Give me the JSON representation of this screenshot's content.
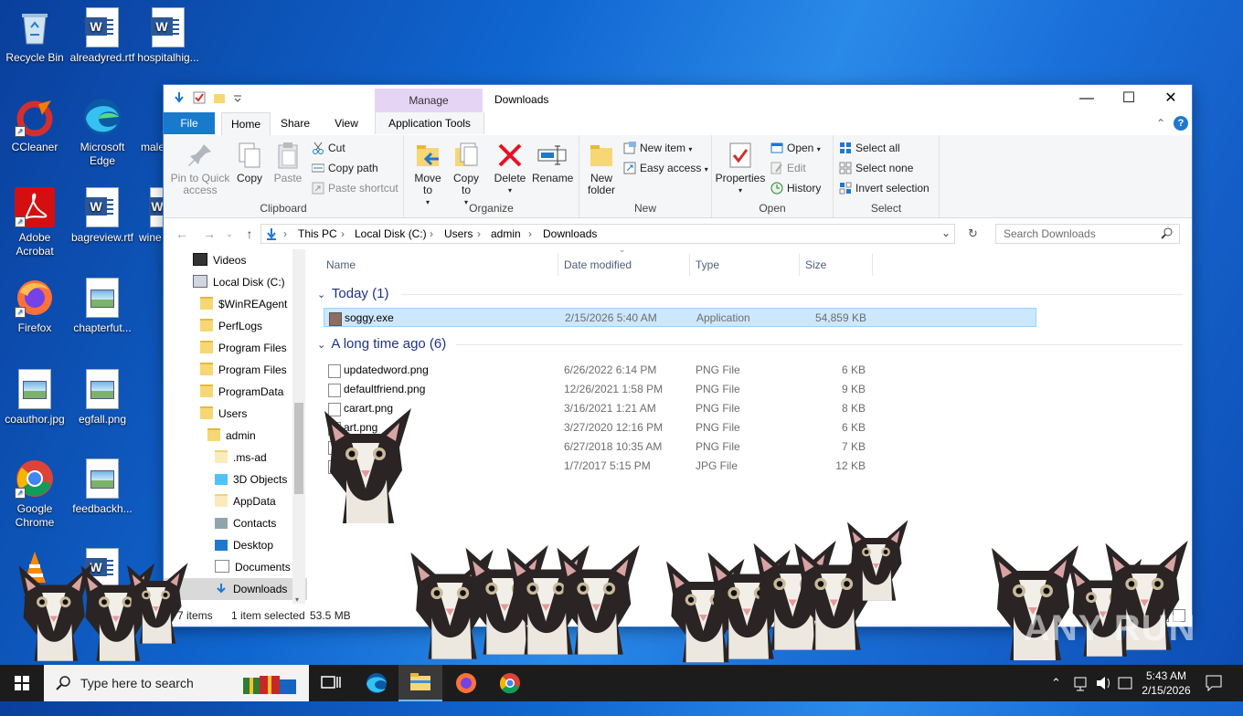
{
  "desktop": {
    "icons": [
      {
        "label": "Recycle Bin",
        "icon": "recycle-bin-icon"
      },
      {
        "label": "alreadyred.rtf",
        "icon": "word-doc-icon"
      },
      {
        "label": "hospitalhig...",
        "icon": "word-doc-icon"
      },
      {
        "label": "CCleaner",
        "icon": "ccleaner-icon"
      },
      {
        "label": "Microsoft Edge",
        "icon": "edge-icon"
      },
      {
        "label": "male",
        "icon": "word-doc-icon"
      },
      {
        "label": "Adobe Acrobat",
        "icon": "acrobat-icon"
      },
      {
        "label": "bagreview.rtf",
        "icon": "word-doc-icon"
      },
      {
        "label": "wine",
        "icon": "word-doc-icon"
      },
      {
        "label": "Firefox",
        "icon": "firefox-icon"
      },
      {
        "label": "chapterfut...",
        "icon": "image-file-icon"
      },
      {
        "label": "coauthor.jpg",
        "icon": "image-file-icon"
      },
      {
        "label": "egfall.png",
        "icon": "image-file-icon"
      },
      {
        "label": "Google Chrome",
        "icon": "chrome-icon"
      },
      {
        "label": "feedbackh...",
        "icon": "image-file-icon"
      },
      {
        "label": "VLC",
        "icon": "vlc-icon"
      }
    ]
  },
  "explorer": {
    "title": "Downloads",
    "manage_label": "Manage",
    "tabs": {
      "file": "File",
      "home": "Home",
      "share": "Share",
      "view": "View",
      "app_tools": "Application Tools"
    },
    "ribbon": {
      "clipboard": {
        "label": "Clipboard",
        "pin": "Pin to Quick access",
        "copy": "Copy",
        "paste": "Paste",
        "cut": "Cut",
        "copy_path": "Copy path",
        "paste_shortcut": "Paste shortcut"
      },
      "organize": {
        "label": "Organize",
        "move_to": "Move to",
        "copy_to": "Copy to",
        "delete": "Delete",
        "rename": "Rename"
      },
      "new": {
        "label": "New",
        "new_folder": "New folder",
        "new_item": "New item",
        "easy_access": "Easy access"
      },
      "open": {
        "label": "Open",
        "properties": "Properties",
        "open": "Open",
        "edit": "Edit",
        "history": "History"
      },
      "select": {
        "label": "Select",
        "select_all": "Select all",
        "select_none": "Select none",
        "invert": "Invert selection"
      }
    },
    "address": {
      "crumbs": [
        "This PC",
        "Local Disk (C:)",
        "Users",
        "admin",
        "Downloads"
      ],
      "search_placeholder": "Search Downloads"
    },
    "nav": [
      {
        "label": "Videos",
        "indent": 1,
        "icon": "videos-icon"
      },
      {
        "label": "Local Disk (C:)",
        "indent": 1,
        "icon": "drive-icon"
      },
      {
        "label": "$WinREAgent",
        "indent": 2,
        "icon": "folder-icon"
      },
      {
        "label": "PerfLogs",
        "indent": 2,
        "icon": "folder-icon"
      },
      {
        "label": "Program Files",
        "indent": 2,
        "icon": "folder-icon"
      },
      {
        "label": "Program Files",
        "indent": 2,
        "icon": "folder-icon"
      },
      {
        "label": "ProgramData",
        "indent": 2,
        "icon": "folder-icon"
      },
      {
        "label": "Users",
        "indent": 2,
        "icon": "folder-icon"
      },
      {
        "label": "admin",
        "indent": 3,
        "icon": "folder-icon"
      },
      {
        "label": ".ms-ad",
        "indent": 4,
        "icon": "folder-icon"
      },
      {
        "label": "3D Objects",
        "indent": 4,
        "icon": "3d-objects-icon"
      },
      {
        "label": "AppData",
        "indent": 4,
        "icon": "folder-icon"
      },
      {
        "label": "Contacts",
        "indent": 4,
        "icon": "contacts-icon"
      },
      {
        "label": "Desktop",
        "indent": 4,
        "icon": "desktop-icon"
      },
      {
        "label": "Documents",
        "indent": 4,
        "icon": "documents-icon"
      },
      {
        "label": "Downloads",
        "indent": 4,
        "icon": "downloads-icon"
      }
    ],
    "columns": {
      "name": "Name",
      "date": "Date modified",
      "type": "Type",
      "size": "Size"
    },
    "groups": [
      {
        "header": "Today (1)",
        "files": [
          {
            "name": "soggy.exe",
            "date": "2/15/2026 5:40 AM",
            "type": "Application",
            "size": "54,859 KB",
            "selected": true
          }
        ]
      },
      {
        "header": "A long time ago (6)",
        "files": [
          {
            "name": "updatedword.png",
            "date": "6/26/2022 6:14 PM",
            "type": "PNG File",
            "size": "6 KB"
          },
          {
            "name": "defaultfriend.png",
            "date": "12/26/2021 1:58 PM",
            "type": "PNG File",
            "size": "9 KB"
          },
          {
            "name": "carart.png",
            "date": "3/16/2021 1:21 AM",
            "type": "PNG File",
            "size": "8 KB"
          },
          {
            "name": "art.png",
            "date": "3/27/2020 12:16 PM",
            "type": "PNG File",
            "size": "6 KB"
          },
          {
            "name": "ng",
            "date": "6/27/2018 10:35 AM",
            "type": "PNG File",
            "size": "7 KB"
          },
          {
            "name": "e.jpg",
            "date": "1/7/2017 5:15 PM",
            "type": "JPG File",
            "size": "12 KB"
          }
        ]
      }
    ],
    "status": {
      "count": "7 items",
      "selected": "1 item selected",
      "size": "53.5 MB"
    }
  },
  "taskbar": {
    "search_placeholder": "Type here to search",
    "time": "5:43 AM",
    "date": "2/15/2026"
  },
  "watermark": "ANY RUN"
}
